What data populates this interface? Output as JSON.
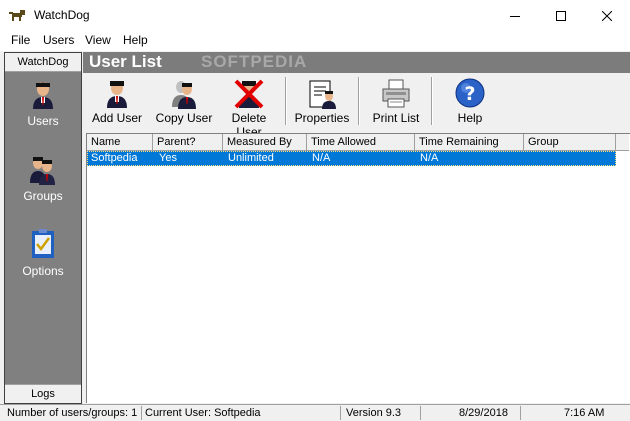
{
  "window": {
    "title": "WatchDog"
  },
  "menu": [
    "File",
    "Users",
    "View",
    "Help"
  ],
  "leftbar": {
    "top_tab": "WatchDog",
    "items": [
      {
        "label": "Users",
        "icon": "user-icon"
      },
      {
        "label": "Groups",
        "icon": "group-icon"
      },
      {
        "label": "Options",
        "icon": "options-icon"
      }
    ],
    "bottom_tab": "Logs"
  },
  "header": {
    "title": "User List",
    "watermark": "SOFTPEDIA"
  },
  "toolbar": {
    "add_user": "Add User",
    "copy_user": "Copy User",
    "delete_user": "Delete User",
    "properties": "Properties",
    "print_list": "Print List",
    "help": "Help"
  },
  "list": {
    "columns": [
      "Name",
      "Parent?",
      "Measured By",
      "Time Allowed",
      "Time Remaining",
      "Group"
    ],
    "rows": [
      [
        "Softpedia",
        "Yes",
        "Unlimited",
        "N/A",
        "N/A",
        ""
      ]
    ]
  },
  "status": {
    "count": "Number of users/groups: 1",
    "current_user": "Current User: Softpedia",
    "version": "Version 9.3",
    "date": "8/29/2018",
    "time": "7:16 AM"
  },
  "colors": {
    "selection": "#0078d7",
    "sidebar": "#808080",
    "header": "#7c7c7c"
  }
}
